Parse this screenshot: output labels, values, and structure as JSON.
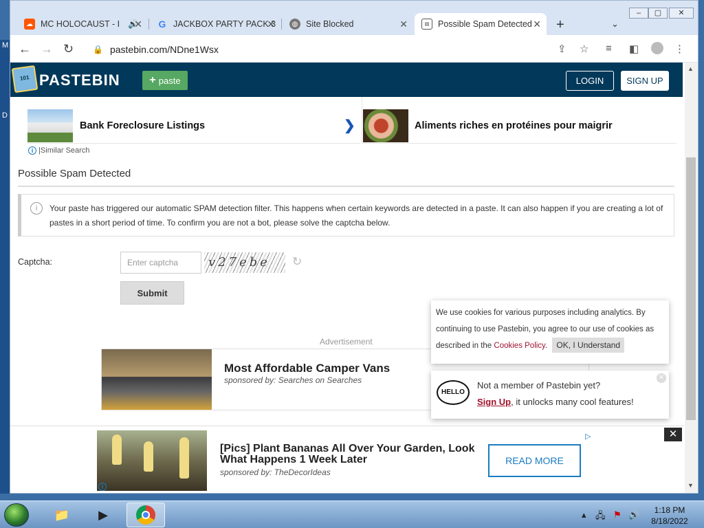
{
  "browser": {
    "tabs": [
      {
        "title": "MC HOLOCAUST - I",
        "icon": "soundcloud-icon"
      },
      {
        "title": "JACKBOX PARTY PACK 3",
        "icon": "google-icon"
      },
      {
        "title": "Site Blocked",
        "icon": "globe-icon"
      },
      {
        "title": "Possible Spam Detected",
        "icon": "pastebin-icon"
      }
    ],
    "url": "pastebin.com/NDne1Wsx"
  },
  "header": {
    "brand": "PASTEBIN",
    "paste_label": "paste",
    "login_label": "LOGIN",
    "signup_label": "SIGN UP"
  },
  "related_ads": {
    "left": "Bank Foreclosure Listings",
    "right": "Aliments riches en protéines pour maigrir",
    "similar_search": "|Similar Search"
  },
  "spam": {
    "title": "Possible Spam Detected",
    "notice": "Your paste has triggered our automatic SPAM detection filter. This happens when certain keywords are detected in a paste. It can also happen if you are creating a lot of pastes in a short period of time. To confirm you are not a bot, please solve the captcha below.",
    "captcha_label": "Captcha:",
    "captcha_placeholder": "Enter captcha",
    "captcha_text": "v27ebe",
    "submit_label": "Submit"
  },
  "ad_middle": {
    "label": "Advertisement",
    "title": "Most Affordable Camper Vans",
    "sponsor": "sponsored by: Searches on Searches"
  },
  "cookie": {
    "text_before": "We use cookies for various purposes including analytics. By continuing to use Pastebin, you agree to our use of cookies as described in the ",
    "link": "Cookies Policy",
    "text_after": ".",
    "ok_label": "OK, I Understand"
  },
  "member_popup": {
    "hello": "HELLO",
    "line1": "Not a member of Pastebin yet?",
    "signup_link": "Sign Up",
    "line2_rest": ", it unlocks many cool features!"
  },
  "bottom_ad": {
    "title": "[Pics] Plant Bananas All Over Your Garden, Look What Happens 1 Week Later",
    "sponsor": "sponsored by: TheDecorIdeas",
    "cta": "READ MORE"
  },
  "taskbar": {
    "time": "1:18 PM",
    "date": "8/18/2022"
  },
  "desktop_letters": [
    "M",
    "D"
  ]
}
